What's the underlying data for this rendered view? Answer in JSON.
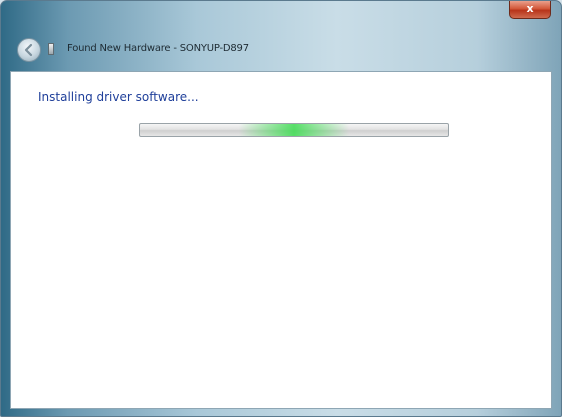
{
  "window": {
    "title": "Found New Hardware - SONYUP-D897",
    "close_label": "x"
  },
  "content": {
    "heading": "Installing driver software..."
  },
  "progress": {
    "mode": "indeterminate",
    "glow_position_fraction": 0.5,
    "glow_color": "#3cdc50"
  },
  "colors": {
    "heading_text": "#1f3f9a",
    "close_button": "#c9452a"
  },
  "icons": {
    "back": "back-arrow-icon",
    "hardware": "hardware-device-icon",
    "close": "close-icon"
  }
}
